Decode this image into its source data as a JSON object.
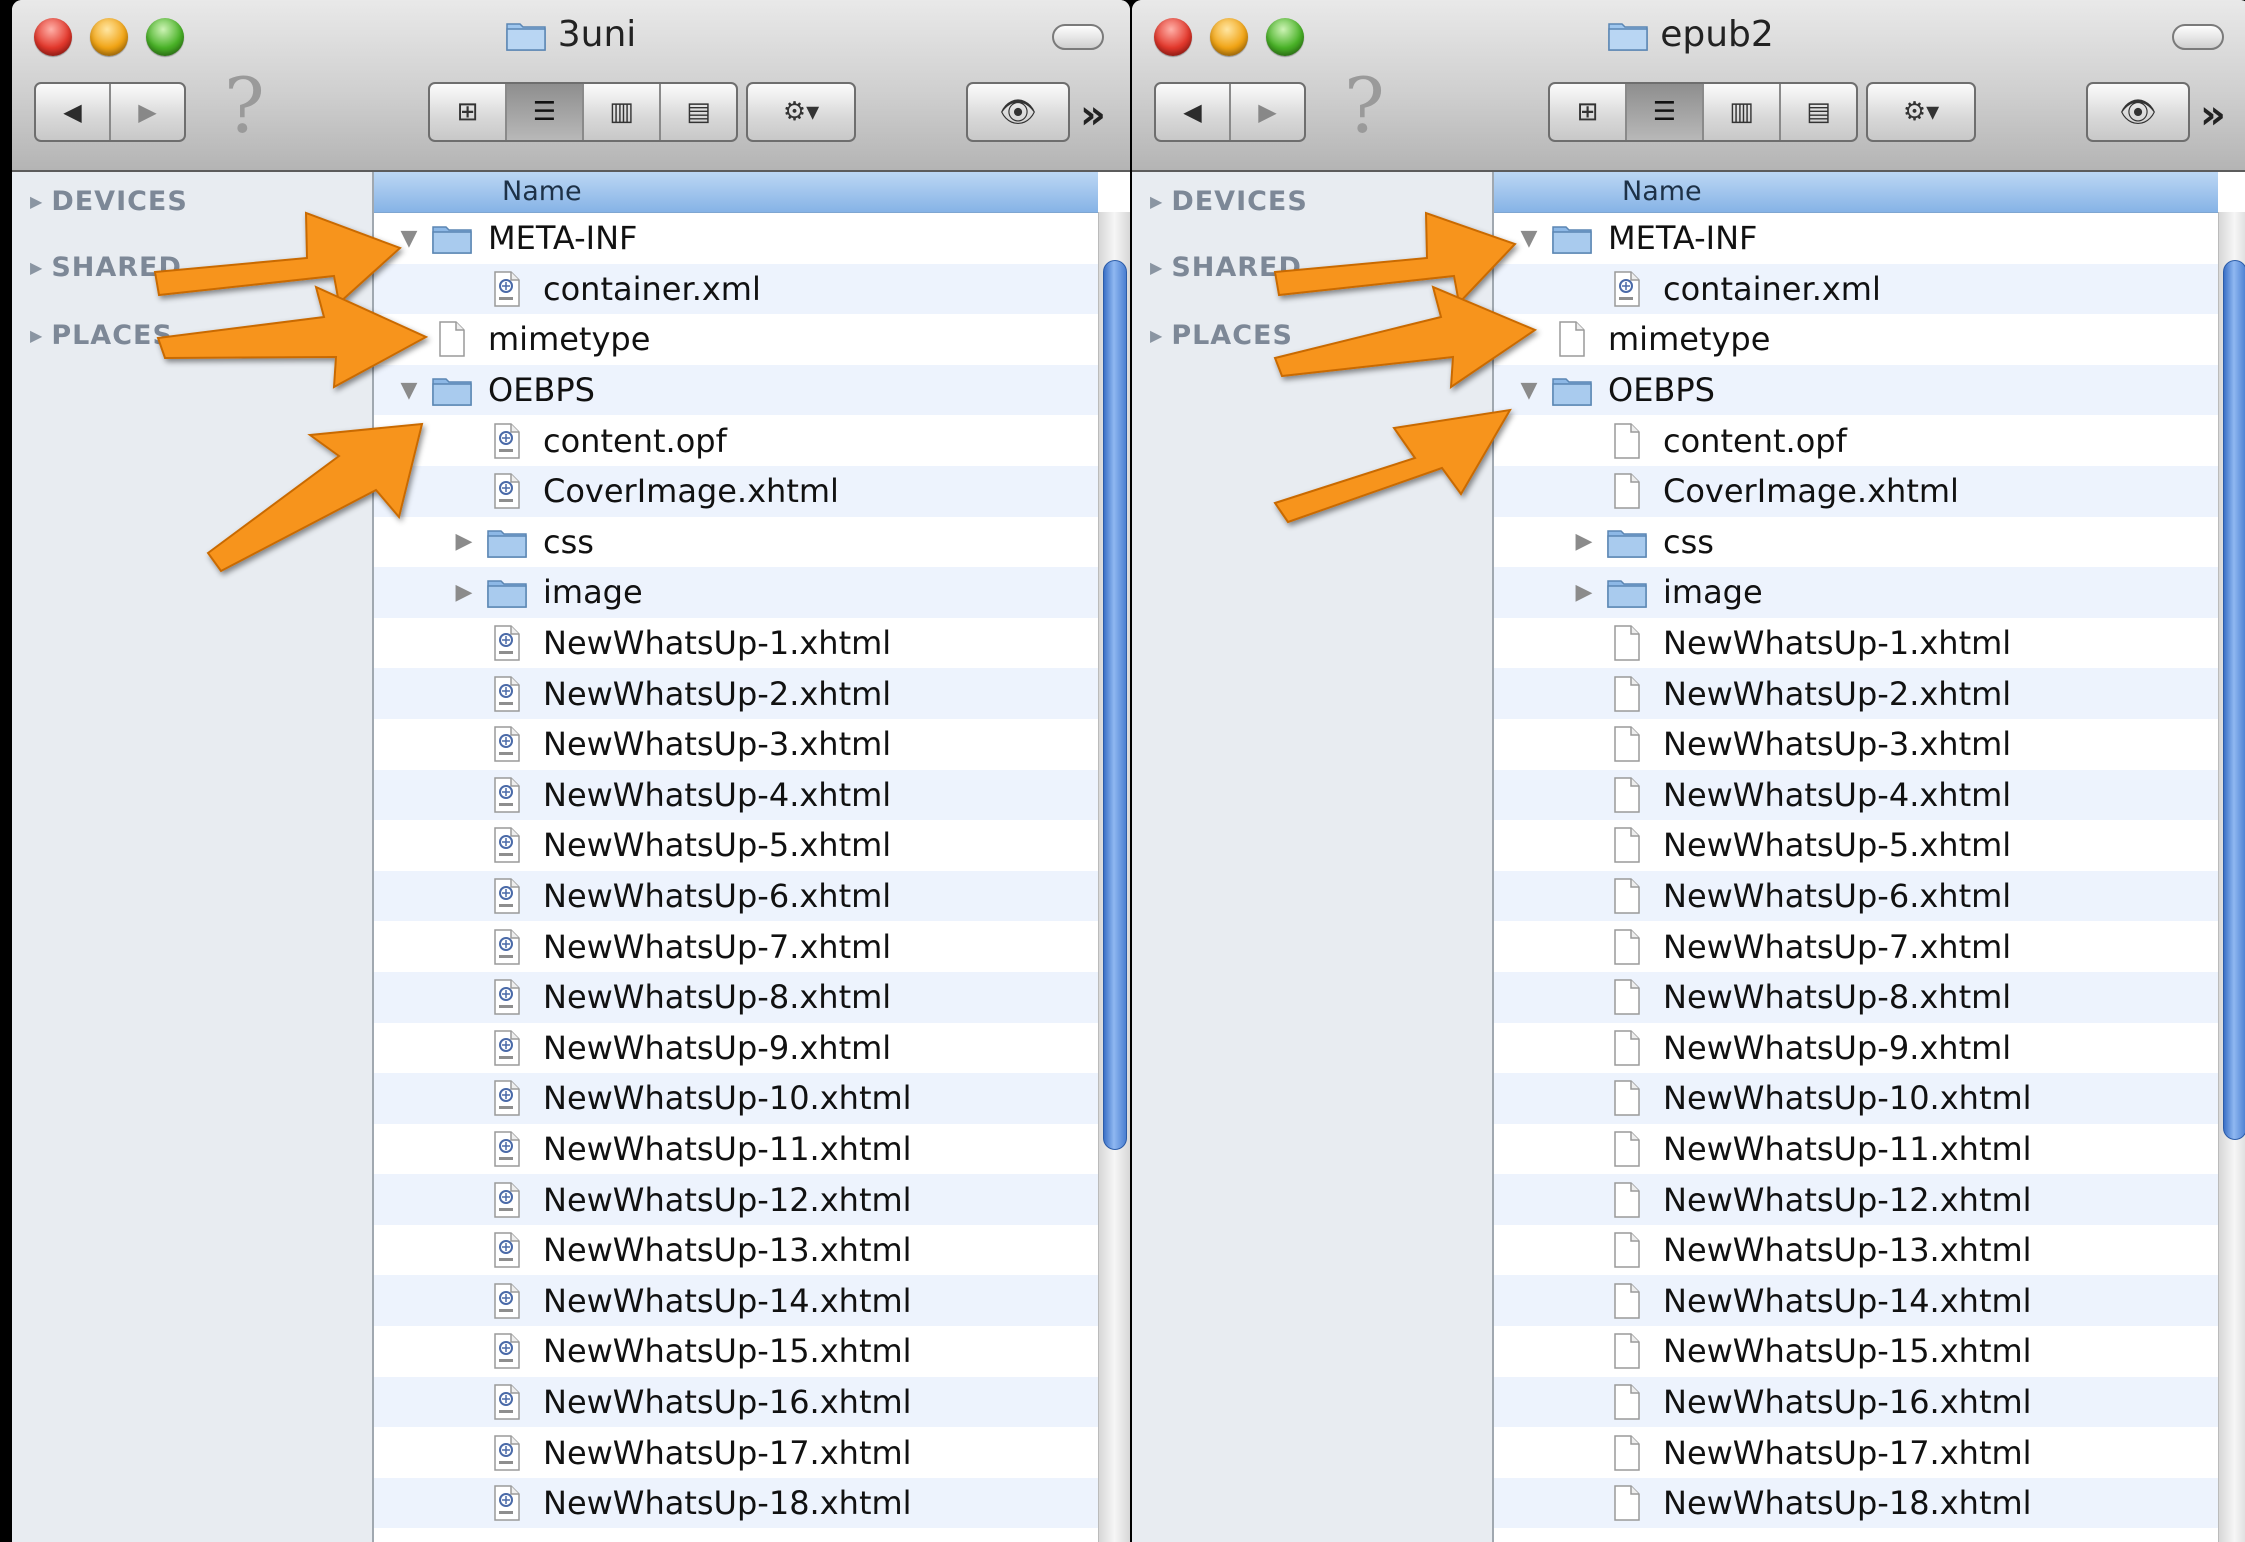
{
  "windows": [
    {
      "title": "3uni",
      "sidebar": [
        "DEVICES",
        "SHARED",
        "PLACES"
      ],
      "column_header": "Name",
      "rows": [
        {
          "name": "META-INF",
          "type": "folder",
          "level": 0,
          "disclosure": "open"
        },
        {
          "name": "container.xml",
          "type": "xml",
          "level": 1
        },
        {
          "name": "mimetype",
          "type": "blank",
          "level": 0
        },
        {
          "name": "OEBPS",
          "type": "folder",
          "level": 0,
          "disclosure": "open"
        },
        {
          "name": "content.opf",
          "type": "xml",
          "level": 1
        },
        {
          "name": "CoverImage.xhtml",
          "type": "xml",
          "level": 1
        },
        {
          "name": "css",
          "type": "folder",
          "level": 1,
          "disclosure": "closed"
        },
        {
          "name": "image",
          "type": "folder",
          "level": 1,
          "disclosure": "closed"
        },
        {
          "name": "NewWhatsUp-1.xhtml",
          "type": "xml",
          "level": 1
        },
        {
          "name": "NewWhatsUp-2.xhtml",
          "type": "xml",
          "level": 1
        },
        {
          "name": "NewWhatsUp-3.xhtml",
          "type": "xml",
          "level": 1
        },
        {
          "name": "NewWhatsUp-4.xhtml",
          "type": "xml",
          "level": 1
        },
        {
          "name": "NewWhatsUp-5.xhtml",
          "type": "xml",
          "level": 1
        },
        {
          "name": "NewWhatsUp-6.xhtml",
          "type": "xml",
          "level": 1
        },
        {
          "name": "NewWhatsUp-7.xhtml",
          "type": "xml",
          "level": 1
        },
        {
          "name": "NewWhatsUp-8.xhtml",
          "type": "xml",
          "level": 1
        },
        {
          "name": "NewWhatsUp-9.xhtml",
          "type": "xml",
          "level": 1
        },
        {
          "name": "NewWhatsUp-10.xhtml",
          "type": "xml",
          "level": 1
        },
        {
          "name": "NewWhatsUp-11.xhtml",
          "type": "xml",
          "level": 1
        },
        {
          "name": "NewWhatsUp-12.xhtml",
          "type": "xml",
          "level": 1
        },
        {
          "name": "NewWhatsUp-13.xhtml",
          "type": "xml",
          "level": 1
        },
        {
          "name": "NewWhatsUp-14.xhtml",
          "type": "xml",
          "level": 1
        },
        {
          "name": "NewWhatsUp-15.xhtml",
          "type": "xml",
          "level": 1
        },
        {
          "name": "NewWhatsUp-16.xhtml",
          "type": "xml",
          "level": 1
        },
        {
          "name": "NewWhatsUp-17.xhtml",
          "type": "xml",
          "level": 1
        },
        {
          "name": "NewWhatsUp-18.xhtml",
          "type": "xml",
          "level": 1
        }
      ]
    },
    {
      "title": "epub2",
      "sidebar": [
        "DEVICES",
        "SHARED",
        "PLACES"
      ],
      "column_header": "Name",
      "rows": [
        {
          "name": "META-INF",
          "type": "folder",
          "level": 0,
          "disclosure": "open"
        },
        {
          "name": "container.xml",
          "type": "xml",
          "level": 1
        },
        {
          "name": "mimetype",
          "type": "blank",
          "level": 0
        },
        {
          "name": "OEBPS",
          "type": "folder",
          "level": 0,
          "disclosure": "open"
        },
        {
          "name": "content.opf",
          "type": "blank",
          "level": 1
        },
        {
          "name": "CoverImage.xhtml",
          "type": "blank",
          "level": 1
        },
        {
          "name": "css",
          "type": "folder",
          "level": 1,
          "disclosure": "closed"
        },
        {
          "name": "image",
          "type": "folder",
          "level": 1,
          "disclosure": "closed"
        },
        {
          "name": "NewWhatsUp-1.xhtml",
          "type": "blank",
          "level": 1
        },
        {
          "name": "NewWhatsUp-2.xhtml",
          "type": "blank",
          "level": 1
        },
        {
          "name": "NewWhatsUp-3.xhtml",
          "type": "blank",
          "level": 1
        },
        {
          "name": "NewWhatsUp-4.xhtml",
          "type": "blank",
          "level": 1
        },
        {
          "name": "NewWhatsUp-5.xhtml",
          "type": "blank",
          "level": 1
        },
        {
          "name": "NewWhatsUp-6.xhtml",
          "type": "blank",
          "level": 1
        },
        {
          "name": "NewWhatsUp-7.xhtml",
          "type": "blank",
          "level": 1
        },
        {
          "name": "NewWhatsUp-8.xhtml",
          "type": "blank",
          "level": 1
        },
        {
          "name": "NewWhatsUp-9.xhtml",
          "type": "blank",
          "level": 1
        },
        {
          "name": "NewWhatsUp-10.xhtml",
          "type": "blank",
          "level": 1
        },
        {
          "name": "NewWhatsUp-11.xhtml",
          "type": "blank",
          "level": 1
        },
        {
          "name": "NewWhatsUp-12.xhtml",
          "type": "blank",
          "level": 1
        },
        {
          "name": "NewWhatsUp-13.xhtml",
          "type": "blank",
          "level": 1
        },
        {
          "name": "NewWhatsUp-14.xhtml",
          "type": "blank",
          "level": 1
        },
        {
          "name": "NewWhatsUp-15.xhtml",
          "type": "blank",
          "level": 1
        },
        {
          "name": "NewWhatsUp-16.xhtml",
          "type": "blank",
          "level": 1
        },
        {
          "name": "NewWhatsUp-17.xhtml",
          "type": "blank",
          "level": 1
        },
        {
          "name": "NewWhatsUp-18.xhtml",
          "type": "blank",
          "level": 1
        }
      ]
    }
  ],
  "icons": {
    "back": "back-arrow-icon",
    "forward": "forward-arrow-icon",
    "help": "question-mark-icon",
    "view_icon": "icon-view-icon",
    "view_list": "list-view-icon",
    "view_column": "column-view-icon",
    "view_coverflow": "coverflow-view-icon",
    "action": "gear-dropdown-icon",
    "quicklook": "eye-icon",
    "overflow": "chevron-double-right-icon"
  },
  "colors": {
    "annotation_arrow": "#f7941d",
    "header_blue": "#9cc3ee",
    "row_alt": "#edf3fd",
    "sidebar_bg": "#e8ecf1",
    "folder_blue": "#8db8e6"
  },
  "active_view": "list"
}
